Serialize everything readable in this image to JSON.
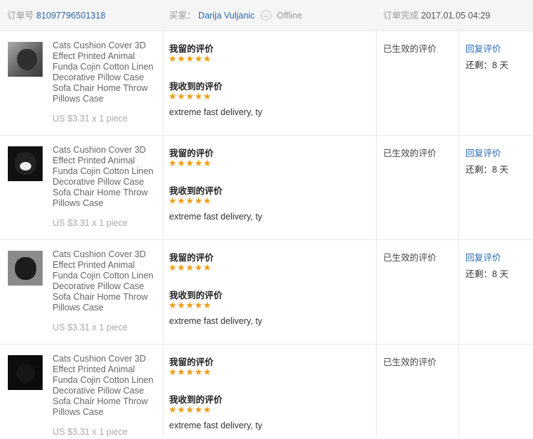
{
  "header": {
    "order_label": "订单号",
    "order_number": "81097796501318",
    "buyer_label": "买家：",
    "buyer_name": "Darija Vuljanic",
    "buyer_status": "Offline",
    "completed_label": "订单完成",
    "completed_time": "2017.01.05 04:29"
  },
  "rows": [
    {
      "title": "Cats Cushion Cover 3D Effect Printed Animal Funda Cojin Cotton Linen Decorative Pillow Case Sofa Chair Home Throw Pillows Case",
      "price": "US $3.31 x 1 piece",
      "my_review_label": "我留的评价",
      "my_stars": "★★★★★",
      "received_label": "我收到的评价",
      "received_stars": "★★★★★",
      "comment": "extreme fast delivery, ty",
      "status": "已生效的评价",
      "reply_label": "回复评价",
      "remain": "还剩：8 天"
    },
    {
      "title": "Cats Cushion Cover 3D Effect Printed Animal Funda Cojin Cotton Linen Decorative Pillow Case Sofa Chair Home Throw Pillows Case",
      "price": "US $3.31 x 1 piece",
      "my_review_label": "我留的评价",
      "my_stars": "★★★★★",
      "received_label": "我收到的评价",
      "received_stars": "★★★★★",
      "comment": "extreme fast delivery, ty",
      "status": "已生效的评价",
      "reply_label": "回复评价",
      "remain": "还剩：8 天"
    },
    {
      "title": "Cats Cushion Cover 3D Effect Printed Animal Funda Cojin Cotton Linen Decorative Pillow Case Sofa Chair Home Throw Pillows Case",
      "price": "US $3.31 x 1 piece",
      "my_review_label": "我留的评价",
      "my_stars": "★★★★★",
      "received_label": "我收到的评价",
      "received_stars": "★★★★★",
      "comment": "extreme fast delivery, ty",
      "status": "已生效的评价",
      "reply_label": "回复评价",
      "remain": "还剩：8 天"
    },
    {
      "title": "Cats Cushion Cover 3D Effect Printed Animal Funda Cojin Cotton Linen Decorative Pillow Case Sofa Chair Home Throw Pillows Case",
      "price": "US $3.31 x 1 piece",
      "my_review_label": "我留的评价",
      "my_stars": "★★★★★",
      "received_label": "我收到的评价",
      "received_stars": "★★★★★",
      "comment": "extreme fast delivery, ty",
      "status": "已生效的评价"
    }
  ],
  "colors": {
    "link": "#2a68b1",
    "star": "#f29b13",
    "header_bg": "#f5f5f5"
  }
}
